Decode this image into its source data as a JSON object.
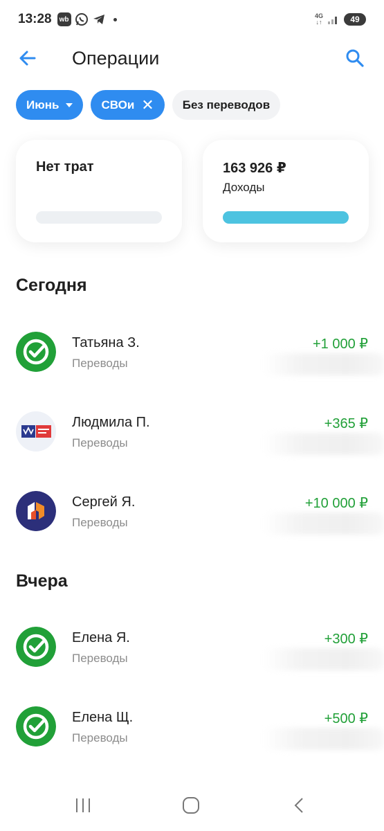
{
  "status_bar": {
    "time": "13:28",
    "app_badge": "wb",
    "network": "4G",
    "battery": "49"
  },
  "header": {
    "title": "Операции"
  },
  "filters": {
    "month_chip": "Июнь",
    "tag_chip": "СВОи",
    "transfers_chip": "Без переводов"
  },
  "summary": {
    "expenses": {
      "title": "Нет трат",
      "progress": 0
    },
    "income": {
      "amount": "163 926 ₽",
      "label": "Доходы",
      "progress": 1.0,
      "color": "#4dc3e0"
    }
  },
  "sections": [
    {
      "title": "Сегодня",
      "items": [
        {
          "name": "Татьяна З.",
          "category": "Переводы",
          "amount": "+1 000 ₽",
          "icon": "sber-check-icon"
        },
        {
          "name": "Людмила П.",
          "category": "Переводы",
          "amount": "+365 ₽",
          "icon": "pochta-bank-icon"
        },
        {
          "name": "Сергей Я.",
          "category": "Переводы",
          "amount": "+10 000 ₽",
          "icon": "bank-logo-icon"
        }
      ]
    },
    {
      "title": "Вчера",
      "items": [
        {
          "name": "Елена Я.",
          "category": "Переводы",
          "amount": "+300 ₽",
          "icon": "sber-check-icon"
        },
        {
          "name": "Елена Щ.",
          "category": "Переводы",
          "amount": "+500 ₽",
          "icon": "sber-check-icon"
        }
      ]
    }
  ],
  "colors": {
    "accent": "#2f8cf0",
    "income_green": "#21a038",
    "sber_green": "#21a038"
  }
}
